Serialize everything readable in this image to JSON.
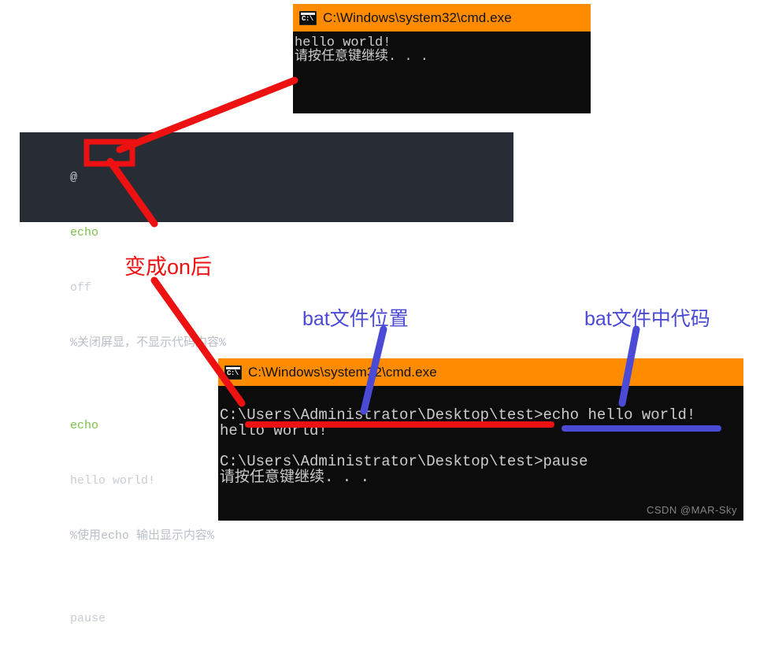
{
  "top_window": {
    "icon": "console-icon",
    "title": "C:\\Windows\\system32\\cmd.exe",
    "lines": [
      "hello world!",
      "请按任意键继续. . ."
    ]
  },
  "code_block": {
    "line1": {
      "at": "@",
      "cmd": "echo",
      "arg": "off",
      "comment_pre": "%关闭屏显，不显示代码内容%"
    },
    "line2": {
      "cmd": "echo",
      "arg": "hello world!",
      "comment": "%使用echo 输出显示内容%"
    },
    "line3": {
      "cmd": "pause"
    }
  },
  "bottom_window": {
    "icon": "console-icon",
    "title": "C:\\Windows\\system32\\cmd.exe",
    "lines": [
      "C:\\Users\\Administrator\\Desktop\\test>echo hello world!",
      "hello world!",
      "",
      "C:\\Users\\Administrator\\Desktop\\test>pause",
      "请按任意键继续. . ."
    ]
  },
  "annotations": {
    "become_on": "变成on后",
    "bat_location": "bat文件位置",
    "bat_code": "bat文件中代码"
  },
  "watermark": "CSDN @MAR-Sky",
  "colors": {
    "titlebar_orange": "#ff8c00",
    "console_black": "#0c0c0c",
    "code_bg": "#282c34",
    "annotation_red": "#ee1111",
    "annotation_blue": "#4a4ad6",
    "keyword_green": "#7ec14b"
  }
}
